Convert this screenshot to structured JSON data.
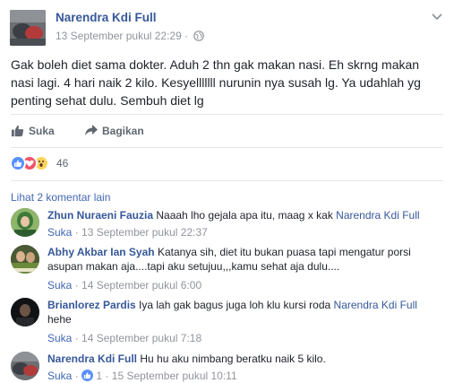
{
  "post": {
    "author": "Narendra Kdi Full",
    "time": "13 September pukul 22:29",
    "separator": "·",
    "text": "Gak boleh diet sama dokter. Aduh 2 thn gak makan nasi. Eh skrng makan nasi lagi. 4 hari naik 2 kilo. Kesyelllllll nurunin nya susah lg. Ya udahlah yg penting sehat dulu. Sembuh diet lg"
  },
  "actions": {
    "like_label": "Suka",
    "share_label": "Bagikan"
  },
  "reactions": {
    "count": "46",
    "types": [
      "like",
      "love",
      "wow"
    ],
    "colors": {
      "like": "#5890ff",
      "love": "#f25268",
      "wow": "#fdd35b"
    }
  },
  "comments_header": {
    "more_label": "Lihat 2 komentar lain"
  },
  "comments": [
    {
      "author": "Zhun Nuraeni Fauzia",
      "text": "Naaah lho gejala apa itu, maag x kak",
      "tag": "Narendra Kdi Full",
      "like_label": "Suka",
      "dot": "·",
      "time": "13 September pukul 22:37"
    },
    {
      "author": "Abhy Akbar Ian Syah",
      "text": "Katanya sih, diet itu bukan puasa tapi mengatur porsi asupan makan aja....tapi aku setujuu,,,kamu sehat aja dulu....",
      "like_label": "Suka",
      "dot": "·",
      "time": "14 September pukul 6:00"
    },
    {
      "author": "Brianlorez Pardis",
      "text": "Iya lah gak bagus juga loh klu kursi roda",
      "tag": "Narendra Kdi Full",
      "text2": "hehe",
      "like_label": "Suka",
      "dot": "·",
      "time": "14 September pukul 7:18"
    },
    {
      "author": "Narendra Kdi Full",
      "text": "Hu hu aku nimbang beratku naik 5 kilo.",
      "like_label": "Suka",
      "dot": "·",
      "like_count": "1",
      "time": "15 September pukul 10:11"
    }
  ],
  "colors": {
    "link": "#365899",
    "meta": "#90949c",
    "text": "#1d2129"
  }
}
